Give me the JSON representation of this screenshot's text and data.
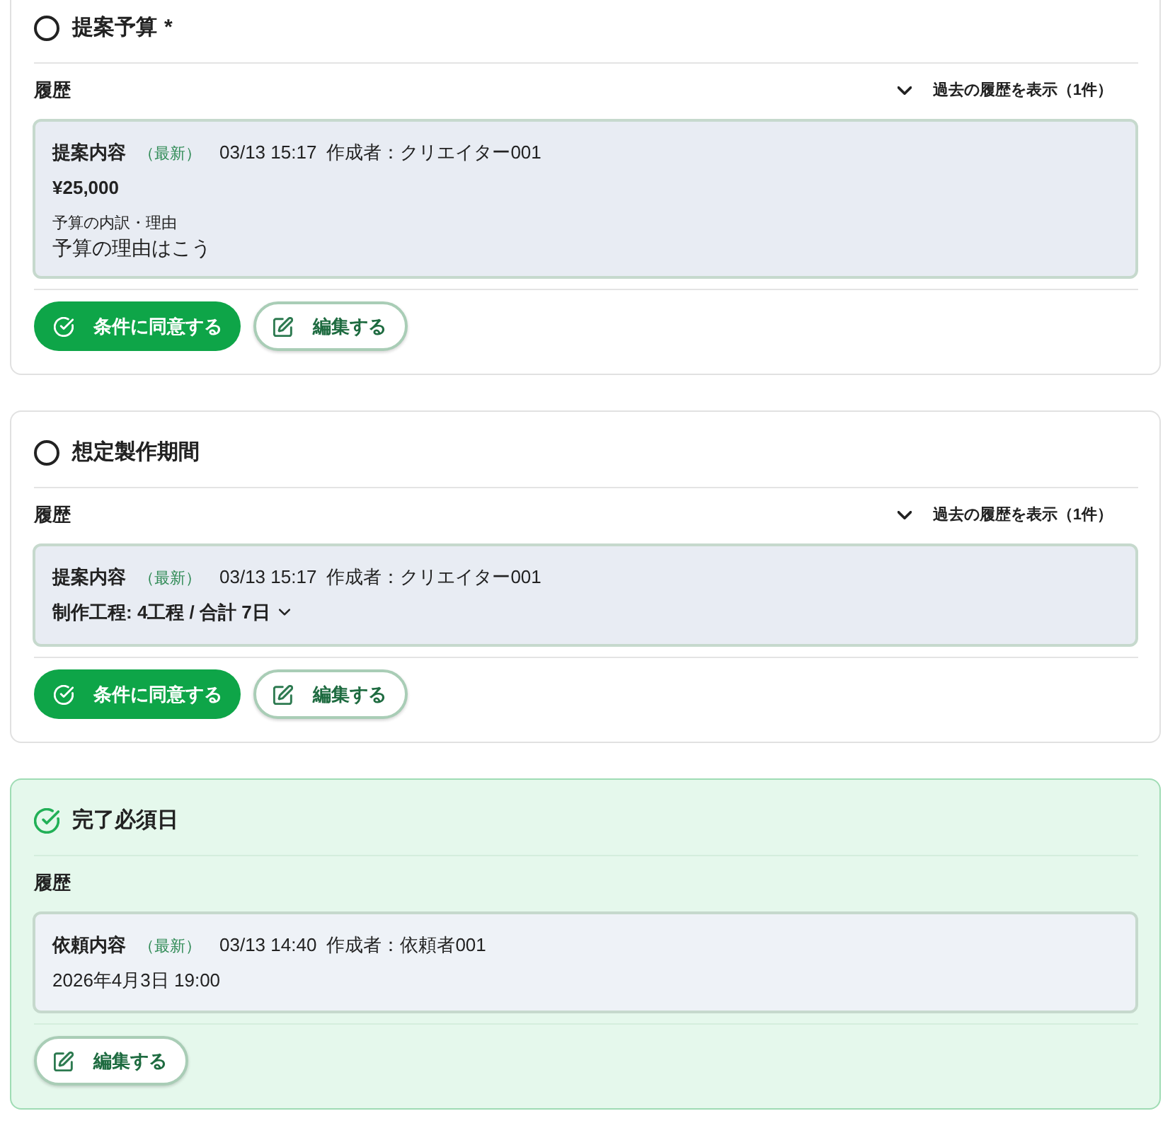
{
  "sections": [
    {
      "title": "提案予算",
      "required_mark": "*",
      "completed": false,
      "history_label": "履歴",
      "history_toggle": {
        "label": "過去の履歴を表示（1件）",
        "expanded": false
      },
      "entry": {
        "type_label": "提案内容",
        "latest_label": "（最新）",
        "timestamp": "03/13 15:17",
        "author": "作成者：クリエイター001",
        "details": [
          {
            "kind": "value",
            "text": "¥25,000"
          },
          {
            "kind": "labeled",
            "label": "予算の内訳・理由",
            "text": "予算の理由はこう"
          }
        ]
      },
      "buttons": [
        {
          "kind": "agree",
          "label": "条件に同意する"
        },
        {
          "kind": "edit",
          "label": "編集する"
        }
      ]
    },
    {
      "title": "想定製作期間",
      "completed": false,
      "history_label": "履歴",
      "history_toggle": {
        "label": "過去の履歴を表示（1件）",
        "expanded": false
      },
      "entry": {
        "type_label": "提案内容",
        "latest_label": "（最新）",
        "timestamp": "03/13 15:17",
        "author": "作成者：クリエイター001",
        "details": [
          {
            "kind": "expandable",
            "text": "制作工程: 4工程 / 合計 7日",
            "expanded": false
          }
        ]
      },
      "buttons": [
        {
          "kind": "agree",
          "label": "条件に同意する"
        },
        {
          "kind": "edit",
          "label": "編集する"
        }
      ]
    },
    {
      "title": "完了必須日",
      "completed": true,
      "history_label": "履歴",
      "entry": {
        "type_label": "依頼内容",
        "latest_label": "（最新）",
        "timestamp": "03/13 14:40",
        "author": "作成者：依頼者001",
        "details": [
          {
            "kind": "plain",
            "text": "2026年4月3日 19:00"
          }
        ]
      },
      "buttons": [
        {
          "kind": "edit",
          "label": "編集する"
        }
      ]
    }
  ]
}
